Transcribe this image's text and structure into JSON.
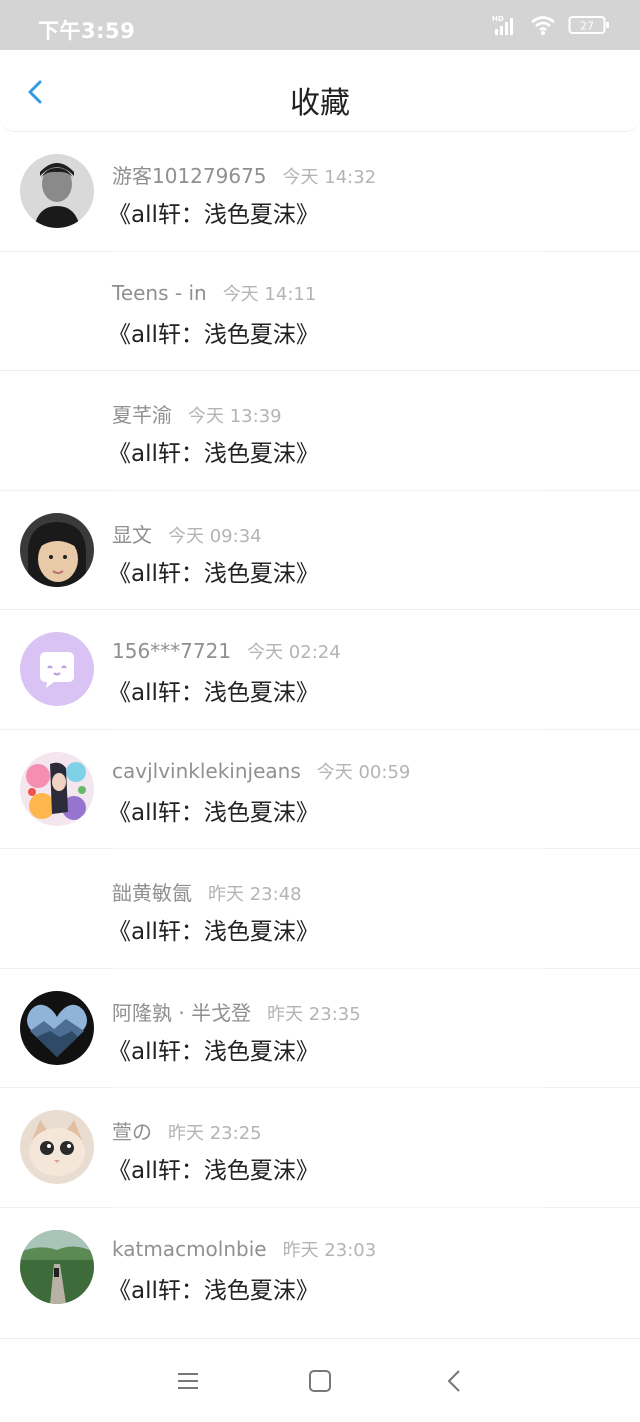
{
  "status_bar": {
    "time": "下午3:59",
    "battery": "27",
    "icons": [
      "hd-signal-icon",
      "wifi-icon",
      "battery-icon"
    ]
  },
  "header": {
    "title": "收藏",
    "back_icon": "chevron-left-icon",
    "accent_color": "#2f9be6"
  },
  "favorites": [
    {
      "user": "游客101279675",
      "time": "今天 14:32",
      "title": "《all轩：浅色夏沫》",
      "avatar": "photo-portrait"
    },
    {
      "user": "Teens - in",
      "time": "今天 14:11",
      "title": "《all轩：浅色夏沫》",
      "avatar": ""
    },
    {
      "user": "夏芊渝",
      "time": "今天 13:39",
      "title": "《all轩：浅色夏沫》",
      "avatar": ""
    },
    {
      "user": "显文",
      "time": "今天 09:34",
      "title": "《all轩：浅色夏沫》",
      "avatar": "photo-portrait"
    },
    {
      "user": "156***7721",
      "time": "今天 02:24",
      "title": "《all轩：浅色夏沫》",
      "avatar": "default-chat-bubble"
    },
    {
      "user": "cavjlvinklekinjeans",
      "time": "今天 00:59",
      "title": "《all轩：浅色夏沫》",
      "avatar": "photo-art"
    },
    {
      "user": "韷黄敏氤",
      "time": "昨天 23:48",
      "title": "《all轩：浅色夏沫》",
      "avatar": ""
    },
    {
      "user": "阿隆孰 · 半戈登",
      "time": "昨天 23:35",
      "title": "《all轩：浅色夏沫》",
      "avatar": "photo-landscape"
    },
    {
      "user": "萱の",
      "time": "昨天 23:25",
      "title": "《all轩：浅色夏沫》",
      "avatar": "photo-cat"
    },
    {
      "user": "katmacmolnbie",
      "time": "昨天 23:03",
      "title": "《all轩：浅色夏沫》",
      "avatar": "photo-path"
    }
  ],
  "bottom_nav": {
    "icons": [
      "menu-icon",
      "home-square-icon",
      "back-triangle-icon"
    ]
  }
}
